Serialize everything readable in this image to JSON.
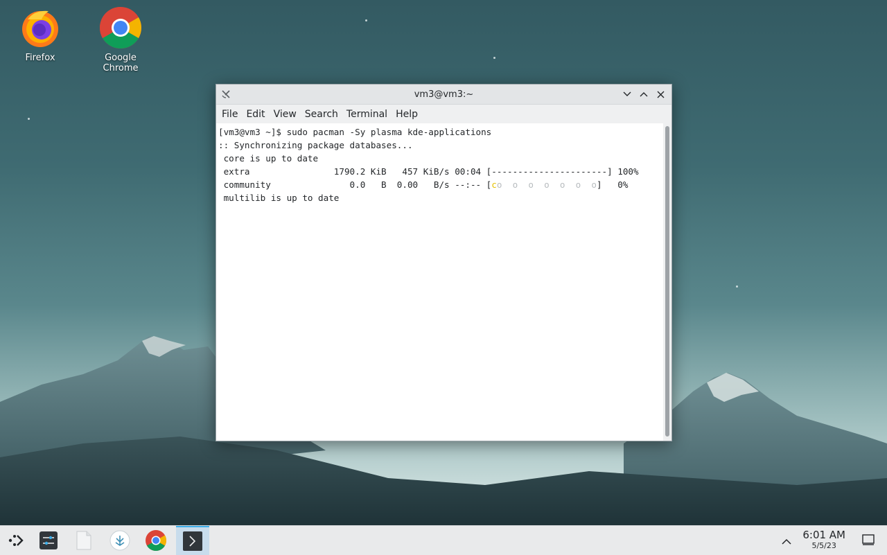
{
  "desktop": {
    "icons": [
      {
        "label": "Firefox",
        "icon": "firefox-icon"
      },
      {
        "label": "Google Chrome",
        "icon": "chrome-icon"
      }
    ]
  },
  "window": {
    "title": "vm3@vm3:~",
    "menu": [
      "File",
      "Edit",
      "View",
      "Search",
      "Terminal",
      "Help"
    ],
    "terminal_lines": [
      "[vm3@vm3 ~]$ sudo pacman -Sy plasma kde-applications",
      ":: Synchronizing package databases...",
      " core is up to date",
      " extra                1790.2 KiB   457 KiB/s 00:04 [----------------------] 100%",
      " community               0.0   B  0.00   B/s --:-- [",
      " multilib is up to date"
    ],
    "community_progress_dots": "o  o  o  o  o  o  o",
    "community_progress_end": "]   0%"
  },
  "taskbar": {
    "items": [
      "application-launcher-icon",
      "system-settings-icon",
      "files-icon",
      "discover-icon",
      "chrome-icon",
      "terminal-icon"
    ],
    "clock_time": "6:01 AM",
    "clock_date": "5/5/23"
  },
  "colors": {
    "accent": "#3daee9",
    "pacman": "#e5c100"
  }
}
